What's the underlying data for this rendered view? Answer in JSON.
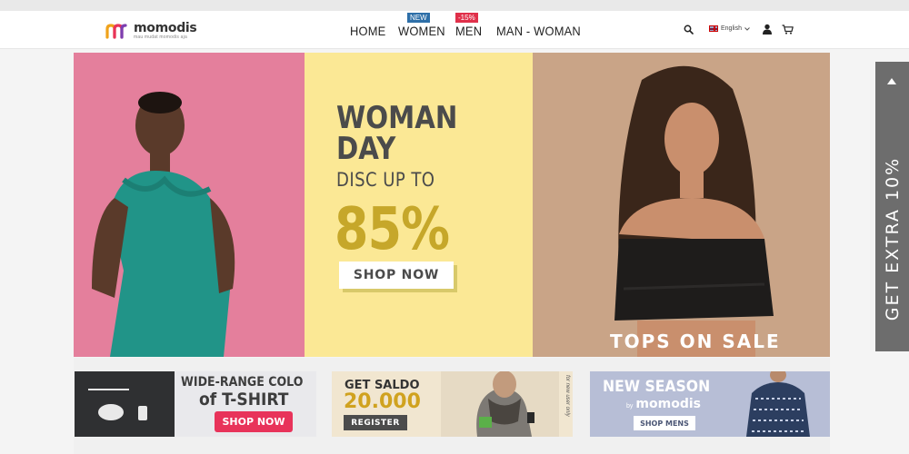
{
  "brand": {
    "name": "momodis",
    "tagline": "mau mudat momodis aja"
  },
  "nav": {
    "items": [
      {
        "label": "HOME"
      },
      {
        "label": "WOMEN",
        "badge": "NEW"
      },
      {
        "label": "MEN",
        "badge": "-15%"
      },
      {
        "label": "MAN - WOMAN"
      }
    ]
  },
  "toolbar": {
    "language": "English"
  },
  "hero": {
    "title_line1": "WOMAN",
    "title_line2": "DAY",
    "subtitle": "DISC UP TO",
    "discount": "85%",
    "cta": "SHOP NOW",
    "right_caption": "TOPS ON SALE"
  },
  "sidetab": {
    "label": "GET EXTRA 10%"
  },
  "banners": [
    {
      "title_line1": "WIDE-RANGE COLO",
      "title_line2": "of T-SHIRT",
      "cta": "SHOP NOW"
    },
    {
      "title_line1": "GET SALDO",
      "amount": "20.000",
      "cta": "REGISTER",
      "note": "for new user only"
    },
    {
      "title_line1": "NEW SEASON",
      "by": "by",
      "brand": "momodis",
      "cta": "SHOP MENS"
    }
  ],
  "colors": {
    "hero_left_bg": "#e47f9c",
    "hero_mid_bg": "#fbe895",
    "hero_right_bg": "#c9a487",
    "discount": "#c6a72a",
    "shop_now_pink": "#e8335a",
    "badge_new": "#2e6fa8",
    "badge_sale": "#e0304a",
    "sidetab_bg": "#6d6d6d"
  },
  "icons": [
    "search-icon",
    "flag-icon",
    "chevron-down-icon",
    "user-icon",
    "cart-icon",
    "arrow-up-icon"
  ]
}
